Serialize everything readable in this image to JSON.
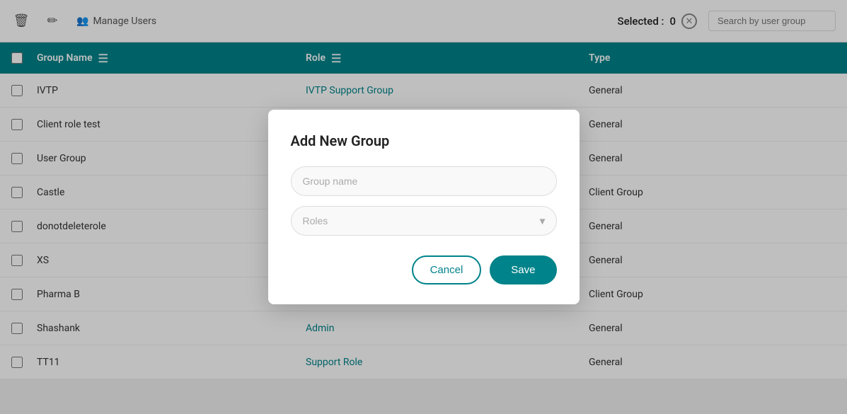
{
  "toolbar": {
    "delete_icon": "🗑",
    "edit_icon": "✏",
    "manage_users_label": "Manage Users",
    "selected_label": "Selected :",
    "selected_count": "0",
    "search_placeholder": "Search by user group"
  },
  "table": {
    "columns": [
      {
        "key": "group_name",
        "label": "Group Name"
      },
      {
        "key": "role",
        "label": "Role"
      },
      {
        "key": "type",
        "label": "Type"
      }
    ],
    "rows": [
      {
        "group_name": "IVTP",
        "role": "IVTP Support Group",
        "type": "General"
      },
      {
        "group_name": "Client role test",
        "role": "",
        "type": "General"
      },
      {
        "group_name": "User Group",
        "role": "",
        "type": "General"
      },
      {
        "group_name": "Castle",
        "role": "",
        "type": "Client Group"
      },
      {
        "group_name": "donotdeleterole",
        "role": "",
        "type": "General"
      },
      {
        "group_name": "XS",
        "role": "",
        "type": "General"
      },
      {
        "group_name": "Pharma B",
        "role": "",
        "type": "Client Group"
      },
      {
        "group_name": "Shashank",
        "role": "Admin",
        "type": "General"
      },
      {
        "group_name": "TT11",
        "role": "Support Role",
        "type": "General"
      }
    ]
  },
  "modal": {
    "title": "Add New Group",
    "group_name_placeholder": "Group name",
    "roles_placeholder": "Roles",
    "cancel_label": "Cancel",
    "save_label": "Save"
  }
}
